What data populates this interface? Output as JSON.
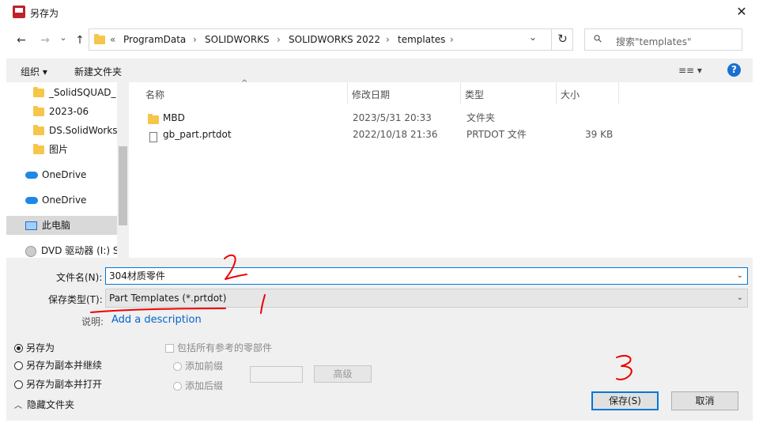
{
  "window": {
    "title": "另存为",
    "close_glyph": "✕"
  },
  "nav": {
    "back": "←",
    "forward": "→",
    "up_menu": "⌄",
    "up": "↑"
  },
  "address": {
    "prefix": "«",
    "crumbs": [
      "ProgramData",
      "SOLIDWORKS",
      "SOLIDWORKS 2022",
      "templates"
    ],
    "separator": "›",
    "dropdown": "⌄",
    "refresh": "↻"
  },
  "search": {
    "placeholder": "搜索\"templates\"",
    "icon": "⚲"
  },
  "toolbar": {
    "organize": "组织 ▾",
    "new_folder": "新建文件夹",
    "view": "≡≡ ▾",
    "help": "?"
  },
  "sidebar": {
    "items": [
      {
        "label": "_SolidSQUAD_",
        "icon": "folder-icon"
      },
      {
        "label": "2023-06",
        "icon": "folder-icon"
      },
      {
        "label": "DS.SolidWorks",
        "icon": "folder-icon"
      },
      {
        "label": "图片",
        "icon": "folder-icon"
      },
      {
        "label": "OneDrive",
        "icon": "cloud-icon"
      },
      {
        "label": "OneDrive",
        "icon": "cloud-icon"
      },
      {
        "label": "此电脑",
        "icon": "pc-icon"
      },
      {
        "label": "DVD 驱动器 (I:) S",
        "icon": "dvd-icon"
      }
    ]
  },
  "columns": {
    "name": "名称",
    "date": "修改日期",
    "type": "类型",
    "size": "大小",
    "sort_glyph": "^"
  },
  "files": [
    {
      "name": "MBD",
      "date": "2023/5/31 20:33",
      "type": "文件夹",
      "size": "",
      "icon": "folder-icon"
    },
    {
      "name": "gb_part.prtdot",
      "date": "2022/10/18 21:36",
      "type": "PRTDOT 文件",
      "size": "39 KB",
      "icon": "file-icon"
    }
  ],
  "form": {
    "filename_label": "文件名(N):",
    "filename_value": "304材质零件",
    "filetype_label": "保存类型(T):",
    "filetype_value": "Part Templates (*.prtdot)",
    "description_label": "说明:",
    "description_link": "Add a description"
  },
  "options": {
    "save_as": "另存为",
    "save_copy_continue": "另存为副本并继续",
    "save_copy_open": "另存为副本并打开",
    "include_refs": "包括所有参考的零部件",
    "add_prefix": "添加前缀",
    "add_suffix": "添加后缀",
    "advanced": "高级"
  },
  "footer": {
    "hide_folders": "隐藏文件夹",
    "save": "保存(S)",
    "cancel": "取消"
  },
  "annotations": {
    "mark1": "1",
    "mark2": "2",
    "mark3": "3",
    "color": "#ee0000"
  }
}
